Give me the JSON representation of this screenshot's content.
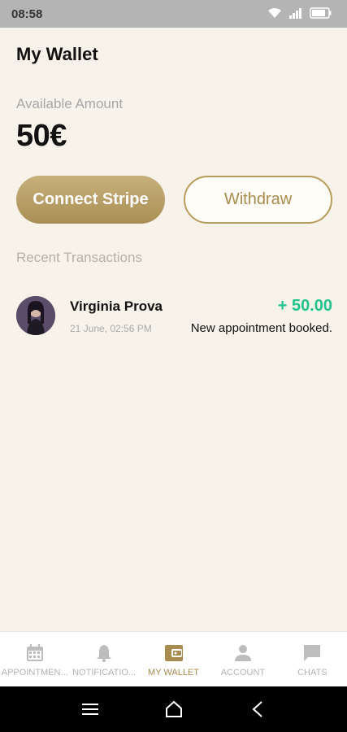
{
  "status": {
    "time": "08:58"
  },
  "header": {
    "title": "My Wallet"
  },
  "wallet": {
    "available_label": "Available Amount",
    "amount": "50€"
  },
  "buttons": {
    "connect_stripe": "Connect Stripe",
    "withdraw": "Withdraw"
  },
  "recent": {
    "label": "Recent Transactions"
  },
  "transactions": [
    {
      "name": "Virginia Prova",
      "amount": "+ 50.00",
      "date": "21 June, 02:56 PM",
      "description": "New appointment booked."
    }
  ],
  "nav": {
    "items": [
      {
        "label": "APPOINTMEN...",
        "icon": "calendar-icon"
      },
      {
        "label": "NOTIFICATIO...",
        "icon": "bell-icon"
      },
      {
        "label": "MY WALLET",
        "icon": "wallet-icon"
      },
      {
        "label": "ACCOUNT",
        "icon": "person-icon"
      },
      {
        "label": "CHATS",
        "icon": "chat-icon"
      }
    ]
  },
  "colors": {
    "accent": "#a88c4f",
    "background": "#f7f3ea",
    "positive": "#22c38e"
  }
}
